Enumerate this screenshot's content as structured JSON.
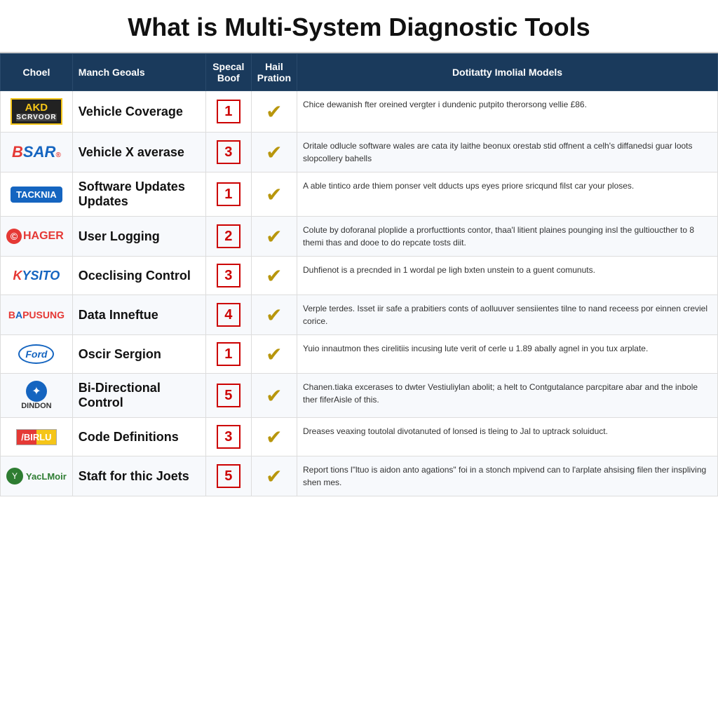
{
  "title": "What is Multi-System Diagnostic Tools",
  "table": {
    "headers": [
      "Choel",
      "Manch Geoals",
      "Specal Boof",
      "Hail Pration",
      "Dotitatty Imolial Models"
    ],
    "rows": [
      {
        "logo_type": "akd",
        "logo_label": "AKD SCRVOOR",
        "feature": "Vehicle Coverage",
        "score": "1",
        "description": "Chice dewanish fter oreined vergter i dundenic putpito therorsong vellie £86."
      },
      {
        "logo_type": "bsar",
        "logo_label": "BSAR",
        "feature": "Vehicle X averase",
        "score": "3",
        "description": "Oritale odlucle software wales are cata ity laithe beonux orestab stid offnent a celh's diffanedsi guar loots slopcollery bahells"
      },
      {
        "logo_type": "tacknia",
        "logo_label": "TACKNIA",
        "feature": "Software Updates Updates",
        "score": "1",
        "description": "A able tintico arde thiem ponser velt dducts ups eyes priore sricqund filst car your ploses."
      },
      {
        "logo_type": "hager",
        "logo_label": "HAGER",
        "feature": "User Logging",
        "score": "2",
        "description": "Colute by doforanal ploplide a prorfucttionts contor, thaa'l litient plaines pounging insl the gultioucther to 8 themi thas and dooe to do repcate tosts diit."
      },
      {
        "logo_type": "kysito",
        "logo_label": "KYSITO",
        "feature": "Oceclising Control",
        "score": "3",
        "description": "Duhfienot is a precnded in 1 wordal pe ligh bxten unstein to a guent comunuts."
      },
      {
        "logo_type": "bapusung",
        "logo_label": "BAPUSUNG",
        "feature": "Data Inneftue",
        "score": "4",
        "description": "Verple terdes. Isset iir safe a prabitiers conts of aolluuver sensiientes tilne to nand receess por einnen creviel corice."
      },
      {
        "logo_type": "ford",
        "logo_label": "Ford",
        "feature": "Oscir Sergion",
        "score": "1",
        "description": "Yuio innautmon thes cirelitiis incusing lute verit of cerle u 1.89 abally agnel in you tux arplate."
      },
      {
        "logo_type": "dindon",
        "logo_label": "DINDON",
        "feature": "Bi-Directional Control",
        "score": "5",
        "description": "Chanen.tiaka excerases to dwter Vestiuliylan abolit; a helt to Contgutalance parcpitare abar and the inbole ther fiferAisle of this."
      },
      {
        "logo_type": "birlu",
        "logo_label": "BIRLU",
        "feature": "Code Definitions",
        "score": "3",
        "description": "Dreases veaxing toutolal divotanuted of lonsed is tleing to Jal to uptrack soluiduct."
      },
      {
        "logo_type": "yaclmoir",
        "logo_label": "YacLMoir",
        "feature": "Staft for thic Joets",
        "score": "5",
        "description": "Report tions l\"ltuo is aidon anto agations\" foi in a stonch mpivend can to l'arplate ahsising filen ther inspliving shen mes."
      }
    ]
  }
}
